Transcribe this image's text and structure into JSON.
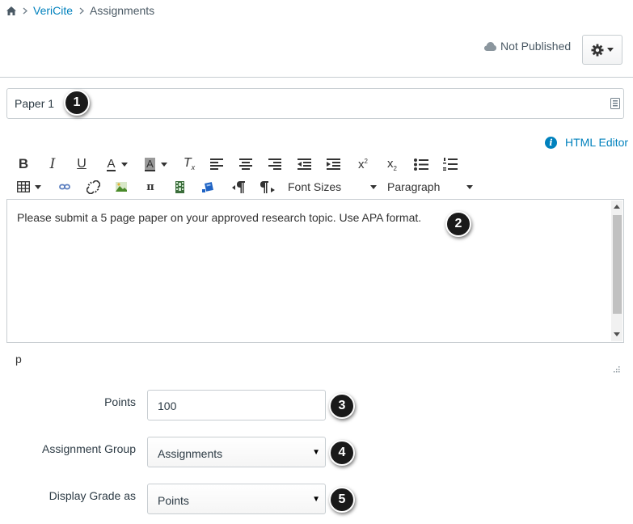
{
  "breadcrumb": {
    "course": "VeriCite",
    "current": "Assignments"
  },
  "header": {
    "publish_status": "Not Published"
  },
  "title_field": {
    "value": "Paper 1"
  },
  "editor": {
    "html_editor_label": "HTML Editor",
    "font_sizes_label": "Font Sizes",
    "format_label": "Paragraph",
    "content": "Please submit a 5 page paper on your approved research topic. Use APA format.",
    "status_path": "p"
  },
  "form": {
    "points": {
      "label": "Points",
      "value": "100"
    },
    "assignment_group": {
      "label": "Assignment Group",
      "value": "Assignments"
    },
    "display_grade": {
      "label": "Display Grade as",
      "value": "Points"
    }
  },
  "callouts": [
    "1",
    "2",
    "3",
    "4",
    "5"
  ],
  "icons": [
    "home-icon",
    "chevron-right-icon",
    "cloud-icon",
    "gear-icon",
    "keyboard-icon",
    "info-icon"
  ],
  "colors": {
    "link": "#0081bd",
    "text": "#2d3b45",
    "border": "#c7cdd1",
    "badge": "#1a1a1a"
  }
}
